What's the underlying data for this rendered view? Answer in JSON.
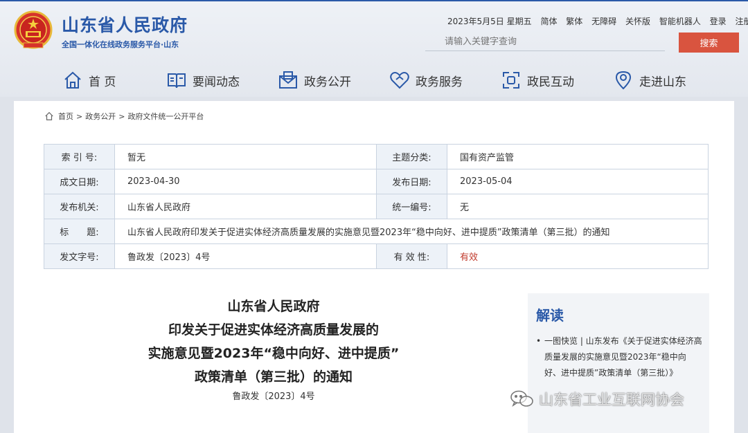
{
  "header": {
    "site_name": "山东省人民政府",
    "site_subtitle": "全国一体化在线政务服务平台·山东",
    "date": "2023年5月5日 星期五",
    "links": [
      "简体",
      "繁体",
      "无障碍",
      "关怀版",
      "智能机器人",
      "登录",
      "注册"
    ],
    "search_placeholder": "请输入关键字查询",
    "search_button": "搜索",
    "emblem_icon": "national-emblem-icon"
  },
  "nav": [
    {
      "label": "首 页",
      "icon": "home-icon"
    },
    {
      "label": "要闻动态",
      "icon": "book-icon"
    },
    {
      "label": "政务公开",
      "icon": "envelope-icon"
    },
    {
      "label": "政务服务",
      "icon": "heart-icon"
    },
    {
      "label": "政民互动",
      "icon": "interaction-icon"
    },
    {
      "label": "走进山东",
      "icon": "location-icon"
    }
  ],
  "breadcrumb": {
    "home": "首页",
    "level1": "政务公开",
    "level2": "政府文件统一公开平台",
    "separator": ">"
  },
  "meta": {
    "index_label": "索 引 号:",
    "index_value": "暂无",
    "topic_label": "主题分类:",
    "topic_value": "国有资产监管",
    "created_label": "成文日期:",
    "created_value": "2023-04-30",
    "published_label": "发布日期:",
    "published_value": "2023-05-04",
    "issuer_label": "发布机关:",
    "issuer_value": "山东省人民政府",
    "serial_label": "统一编号:",
    "serial_value": "无",
    "title_label": "标　　题:",
    "title_value": "山东省人民政府印发关于促进实体经济高质量发展的实施意见暨2023年“稳中向好、进中提质”政策清单（第三批）的通知",
    "docno_label": "发文字号:",
    "docno_value": "鲁政发〔2023〕4号",
    "validity_label": "有 效 性:",
    "validity_value": "有效"
  },
  "document": {
    "title_lines": [
      "山东省人民政府",
      "印发关于促进实体经济高质量发展的",
      "实施意见暨2023年“稳中向好、进中提质”",
      "政策清单（第三批）的通知"
    ],
    "doc_number": "鲁政发〔2023〕4号"
  },
  "aside": {
    "title": "解读",
    "item": "一图快览 | 山东发布《关于促进实体经济高质量发展的实施意见暨2023年“稳中向好、进中提质”政策清单（第三批）》"
  },
  "watermark": {
    "text": "山东省工业互联网协会",
    "icon": "wechat-icon"
  },
  "colors": {
    "brand_blue": "#2a59a8",
    "search_red": "#d9543f",
    "valid_red": "#c0392b"
  }
}
